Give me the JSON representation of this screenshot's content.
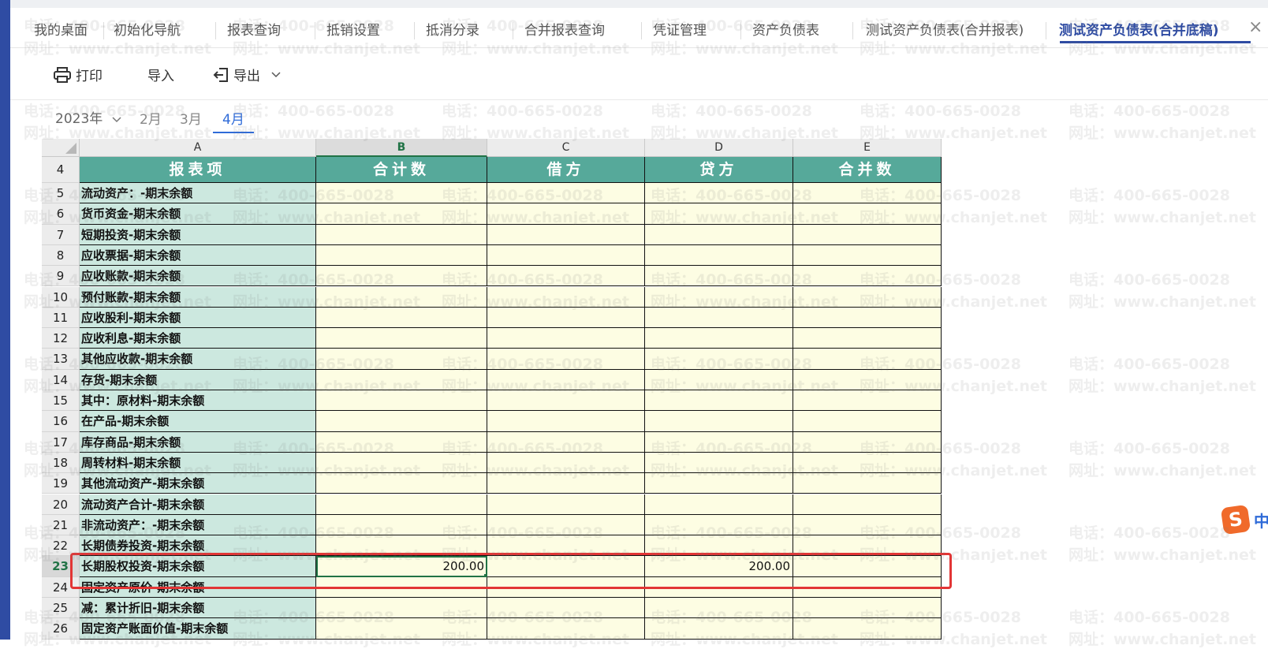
{
  "tabs": [
    {
      "label": "我的桌面"
    },
    {
      "label": "初始化导航"
    },
    {
      "label": "报表查询"
    },
    {
      "label": "抵销设置"
    },
    {
      "label": "抵消分录"
    },
    {
      "label": "合并报表查询"
    },
    {
      "label": "凭证管理"
    },
    {
      "label": "资产负债表"
    },
    {
      "label": "测试资产负债表(合并报表)"
    },
    {
      "label": "测试资产负债表(合并底稿)",
      "active": true
    }
  ],
  "tab_close": "×",
  "toolbar": {
    "print_label": "打印",
    "import_label": "导入",
    "export_label": "导出"
  },
  "period": {
    "year": "2023年",
    "months": [
      "2月",
      "3月",
      "4月"
    ],
    "active_month": "4月"
  },
  "sheet": {
    "columns": [
      "A",
      "B",
      "C",
      "D",
      "E"
    ],
    "selected_column": "B",
    "header_row": {
      "row": "4",
      "cells": [
        "报表项",
        "合计数",
        "借方",
        "贷方",
        "合并数"
      ]
    },
    "selected_row": "23",
    "rows": [
      {
        "row": "5",
        "label": "流动资产：-期末余额",
        "b": "",
        "c": "",
        "d": "",
        "e": ""
      },
      {
        "row": "6",
        "label": "货币资金-期末余额",
        "b": "",
        "c": "",
        "d": "",
        "e": ""
      },
      {
        "row": "7",
        "label": "短期投资-期末余额",
        "b": "",
        "c": "",
        "d": "",
        "e": ""
      },
      {
        "row": "8",
        "label": "应收票据-期末余额",
        "b": "",
        "c": "",
        "d": "",
        "e": ""
      },
      {
        "row": "9",
        "label": "应收账款-期末余额",
        "b": "",
        "c": "",
        "d": "",
        "e": ""
      },
      {
        "row": "10",
        "label": "预付账款-期末余额",
        "b": "",
        "c": "",
        "d": "",
        "e": ""
      },
      {
        "row": "11",
        "label": "应收股利-期末余额",
        "b": "",
        "c": "",
        "d": "",
        "e": ""
      },
      {
        "row": "12",
        "label": "应收利息-期末余额",
        "b": "",
        "c": "",
        "d": "",
        "e": ""
      },
      {
        "row": "13",
        "label": "其他应收款-期末余额",
        "b": "",
        "c": "",
        "d": "",
        "e": ""
      },
      {
        "row": "14",
        "label": "存货-期末余额",
        "b": "",
        "c": "",
        "d": "",
        "e": ""
      },
      {
        "row": "15",
        "label": "其中：原材料-期末余额",
        "b": "",
        "c": "",
        "d": "",
        "e": ""
      },
      {
        "row": "16",
        "label": "在产品-期末余额",
        "b": "",
        "c": "",
        "d": "",
        "e": ""
      },
      {
        "row": "17",
        "label": "库存商品-期末余额",
        "b": "",
        "c": "",
        "d": "",
        "e": ""
      },
      {
        "row": "18",
        "label": "周转材料-期末余额",
        "b": "",
        "c": "",
        "d": "",
        "e": ""
      },
      {
        "row": "19",
        "label": "其他流动资产-期末余额",
        "b": "",
        "c": "",
        "d": "",
        "e": ""
      },
      {
        "row": "20",
        "label": "流动资产合计-期末余额",
        "b": "",
        "c": "",
        "d": "",
        "e": ""
      },
      {
        "row": "21",
        "label": "非流动资产：-期末余额",
        "b": "",
        "c": "",
        "d": "",
        "e": ""
      },
      {
        "row": "22",
        "label": "长期债券投资-期末余额",
        "b": "",
        "c": "",
        "d": "",
        "e": ""
      },
      {
        "row": "23",
        "label": "长期股权投资-期末余额",
        "b": "200.00",
        "c": "",
        "d": "200.00",
        "e": ""
      },
      {
        "row": "24",
        "label": "固定资产原价-期末余额",
        "b": "",
        "c": "",
        "d": "",
        "e": ""
      },
      {
        "row": "25",
        "label": "减：累计折旧-期末余额",
        "b": "",
        "c": "",
        "d": "",
        "e": ""
      },
      {
        "row": "26",
        "label": "固定资产账面价值-期末余额",
        "b": "",
        "c": "",
        "d": "",
        "e": ""
      }
    ]
  },
  "watermark": {
    "phone": "电话：400-665-0028",
    "site": "网址：www.chanjet.net"
  },
  "ime": {
    "logo": "S",
    "mode": "中"
  },
  "colors": {
    "accent": "#2f4ca3",
    "header_fill": "#56a99a",
    "label_fill": "#cce8df",
    "data_fill": "#fdfde3",
    "highlight": "#e23535",
    "excel_green": "#217346"
  }
}
